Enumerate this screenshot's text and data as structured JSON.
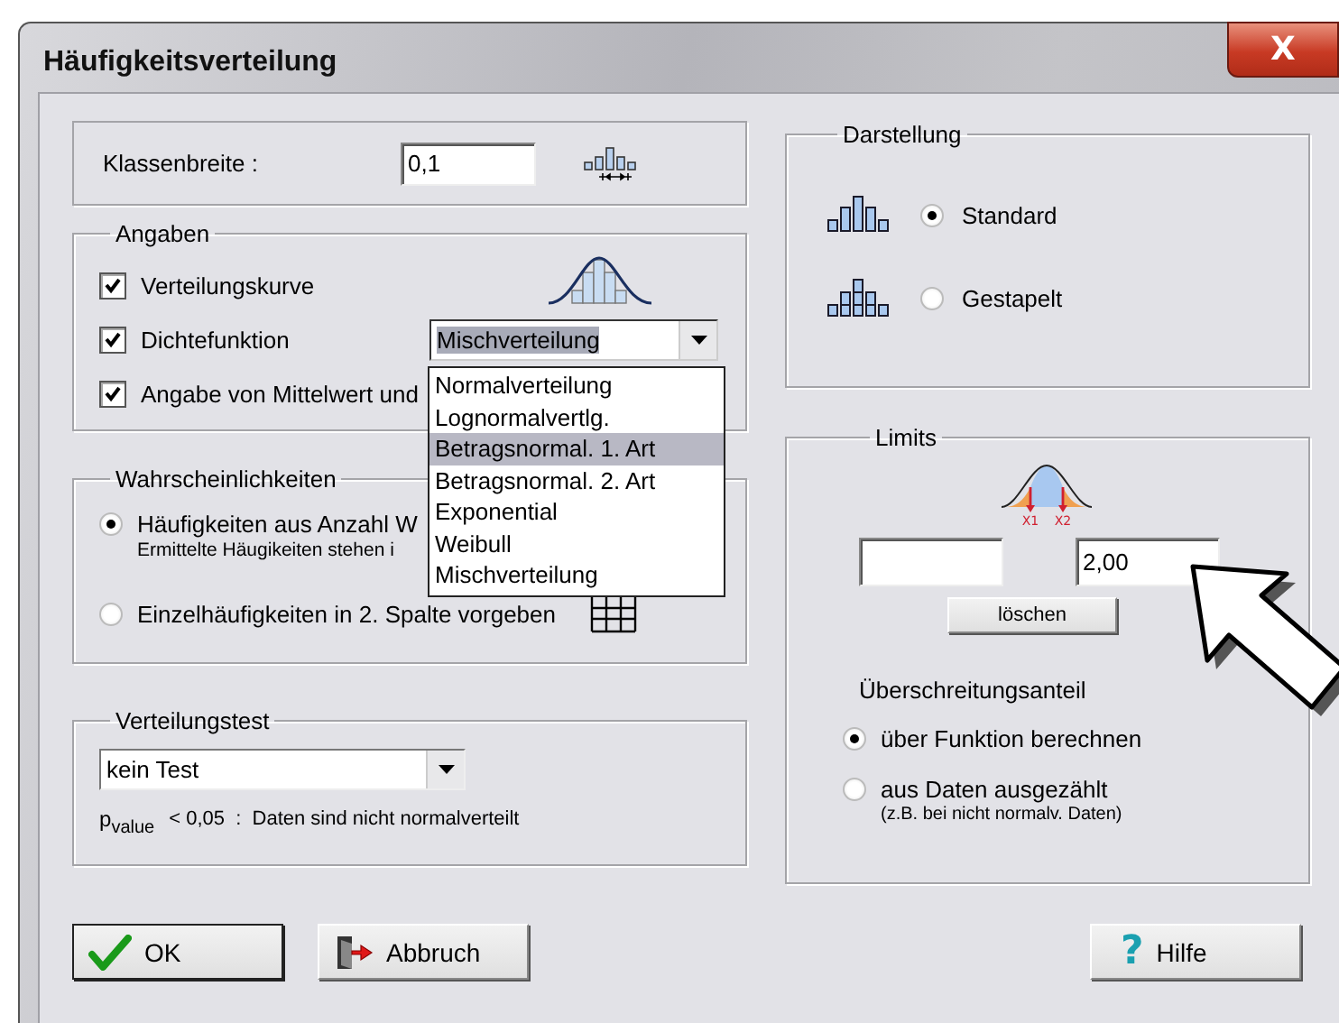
{
  "window": {
    "title": "Häufigkeitsverteilung",
    "close_label": "X"
  },
  "class_width": {
    "label": "Klassenbreite :",
    "value": "0,1"
  },
  "angaben": {
    "title": "Angaben",
    "options": [
      {
        "label": "Verteilungskurve",
        "checked": true
      },
      {
        "label": "Dichtefunktion",
        "checked": true
      },
      {
        "label": "Angabe von Mittelwert und",
        "checked": true
      }
    ],
    "dropdown": {
      "value": "Mischverteilung",
      "expanded": true,
      "options": [
        {
          "label": "Normalverteilung",
          "highlighted": false
        },
        {
          "label": "Lognormalvertlg.",
          "highlighted": false
        },
        {
          "label": "Betragsnormal. 1. Art",
          "highlighted": true
        },
        {
          "label": "Betragsnormal. 2. Art",
          "highlighted": false
        },
        {
          "label": "Exponential",
          "highlighted": false
        },
        {
          "label": "Weibull",
          "highlighted": false
        },
        {
          "label": "Mischverteilung",
          "highlighted": false
        }
      ]
    }
  },
  "probabilities": {
    "title": "Wahrscheinlichkeiten",
    "options": [
      {
        "label": "Häufigkeiten aus Anzahl W",
        "note": "Ermittelte Häugikeiten stehen i",
        "selected": true
      },
      {
        "label": "Einzelhäufigkeiten in 2. Spalte vorgeben",
        "selected": false
      }
    ]
  },
  "test": {
    "title": "Verteilungstest",
    "value": "kein Test",
    "p_label": "p$_{value}$",
    "p_text": "< 0,05  :  Daten sind nicht normalverteilt"
  },
  "display": {
    "title": "Darstellung",
    "options": [
      {
        "label": "Standard",
        "kind": "standard",
        "selected": true
      },
      {
        "label": "Gestapelt",
        "kind": "stacked",
        "selected": false
      }
    ]
  },
  "limits": {
    "title": "Limits",
    "marks": [
      "X1",
      "X2"
    ],
    "upper": "2,00",
    "clear_button": "löschen",
    "exceed_title": "Überschreitungsanteil",
    "options": [
      {
        "label": "über Funktion berechnen",
        "selected": true
      },
      {
        "label": "aus Daten ausgezählt",
        "note": "(z.B. bei nicht normalv. Daten)",
        "selected": false
      }
    ]
  },
  "buttons": [
    {
      "label": "OK",
      "kind": "ok"
    },
    {
      "label": "Abbruch",
      "kind": "cancel"
    },
    {
      "label": "Hilfe",
      "kind": "help",
      "glyph": "?"
    }
  ]
}
